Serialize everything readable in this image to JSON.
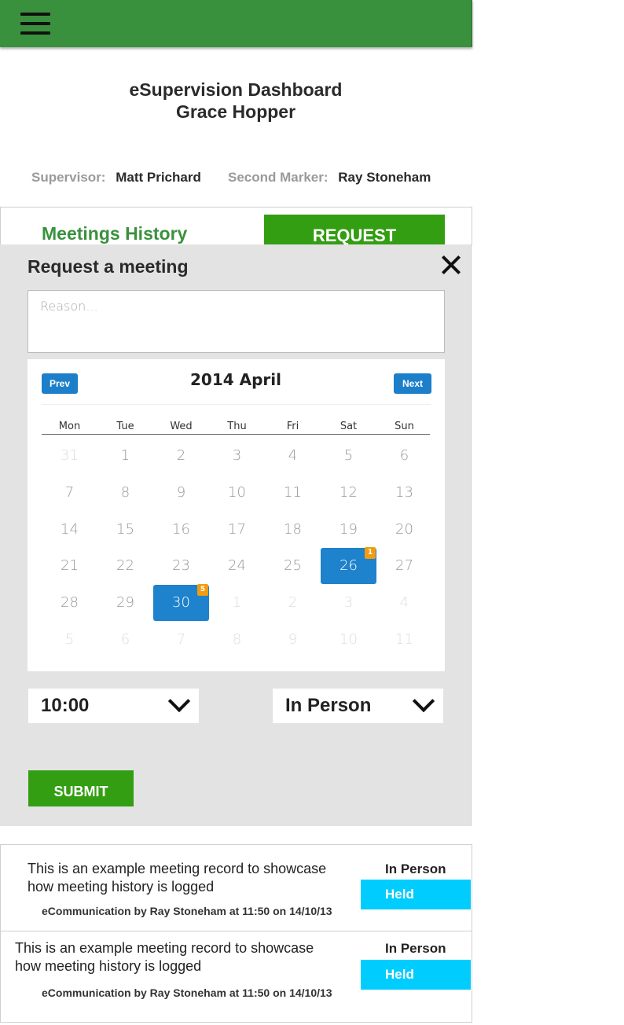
{
  "header": {
    "menu_icon": "hamburger-menu-icon",
    "bar_color": "#3a913d"
  },
  "dashboard": {
    "title": "eSupervision Dashboard",
    "student_name": "Grace Hopper"
  },
  "people": {
    "supervisor_label": "Supervisor:",
    "supervisor_name": "Matt Prichard",
    "second_marker_label": "Second Marker:",
    "second_marker_name": "Ray Stoneham"
  },
  "meetings": {
    "title": "Meetings History",
    "request_label": "REQUEST"
  },
  "modal": {
    "title": "Request a meeting",
    "close_icon": "close-icon",
    "reason_placeholder": "Reason...",
    "calendar": {
      "prev_label": "Prev",
      "next_label": "Next",
      "month_title": "2014 April",
      "weekdays": [
        "Mon",
        "Tue",
        "Wed",
        "Thu",
        "Fri",
        "Sat",
        "Sun"
      ],
      "weeks": [
        [
          {
            "d": "31",
            "other": true
          },
          {
            "d": "1"
          },
          {
            "d": "2"
          },
          {
            "d": "3"
          },
          {
            "d": "4"
          },
          {
            "d": "5"
          },
          {
            "d": "6"
          }
        ],
        [
          {
            "d": "7"
          },
          {
            "d": "8"
          },
          {
            "d": "9"
          },
          {
            "d": "10"
          },
          {
            "d": "11"
          },
          {
            "d": "12"
          },
          {
            "d": "13"
          }
        ],
        [
          {
            "d": "14"
          },
          {
            "d": "15"
          },
          {
            "d": "16"
          },
          {
            "d": "17"
          },
          {
            "d": "18"
          },
          {
            "d": "19"
          },
          {
            "d": "20"
          }
        ],
        [
          {
            "d": "21"
          },
          {
            "d": "22"
          },
          {
            "d": "23"
          },
          {
            "d": "24"
          },
          {
            "d": "25"
          },
          {
            "d": "26",
            "selected": true,
            "badge": "1"
          },
          {
            "d": "27"
          }
        ],
        [
          {
            "d": "28"
          },
          {
            "d": "29"
          },
          {
            "d": "30",
            "selected": true,
            "badge": "5"
          },
          {
            "d": "1",
            "other": true
          },
          {
            "d": "2",
            "other": true
          },
          {
            "d": "3",
            "other": true
          },
          {
            "d": "4",
            "other": true
          }
        ],
        [
          {
            "d": "5",
            "other": true
          },
          {
            "d": "6",
            "other": true
          },
          {
            "d": "7",
            "other": true
          },
          {
            "d": "8",
            "other": true
          },
          {
            "d": "9",
            "other": true
          },
          {
            "d": "10",
            "other": true
          },
          {
            "d": "11",
            "other": true
          }
        ]
      ],
      "selected_color": "#1e82cc",
      "badge_color": "#f39c12"
    },
    "time_value": "10:00",
    "type_value": "In Person",
    "submit_label": "SUBMIT"
  },
  "records": [
    {
      "text": "This is an example meeting record to showcase how meeting history is logged",
      "meta": "eCommunication by Ray Stoneham at 11:50 on 14/10/13",
      "type": "In Person",
      "status": "Held"
    },
    {
      "text": "This is an example meeting record to showcase how meeting history is logged",
      "meta": "eCommunication by Ray Stoneham at 11:50 on 14/10/13",
      "type": "In Person",
      "status": "Held"
    }
  ],
  "colors": {
    "accent_green": "#339e12",
    "status_cyan": "#00cdfe",
    "calendar_blue": "#1d7fc9"
  }
}
